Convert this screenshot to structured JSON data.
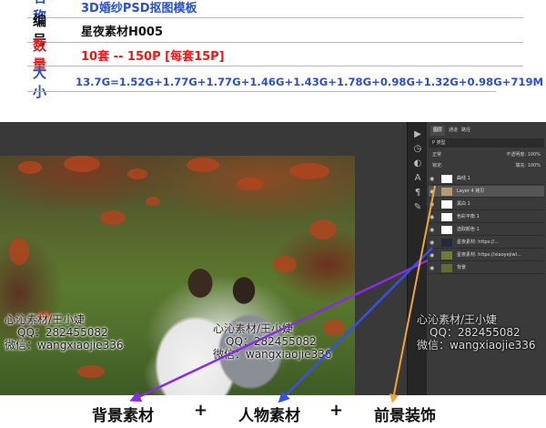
{
  "info": {
    "rows": [
      {
        "key": "名称",
        "value": "3D婚纱PSD抠图模板"
      },
      {
        "key": "编号",
        "value": "星夜素材H005"
      },
      {
        "key": "数量",
        "value": "10套 -- 150P [每套15P]"
      },
      {
        "key": "大小",
        "value": "13.7G=1.52G+1.77G+1.77G+1.46G+1.43G+1.78G+0.98G+1.32G+0.98G+719M"
      }
    ]
  },
  "layers_panel": {
    "tabs": [
      "图层",
      "通道",
      "路径"
    ],
    "filter_label": "P 类型",
    "mode_label": "正常",
    "opacity_label": "不透明度: 100%",
    "lock_label": "锁定:",
    "fill_label": "填充: 100%",
    "layers": [
      {
        "name": "曲线 1"
      },
      {
        "name": "Layer 4 拷贝"
      },
      {
        "name": "黑白 1"
      },
      {
        "name": "色彩平衡 1"
      },
      {
        "name": "选取颜色 1"
      },
      {
        "name": "星夜素材: https://..."
      },
      {
        "name": "星夜素材: https://xiaoyejiwl..."
      },
      {
        "name": "背景"
      }
    ]
  },
  "watermark": {
    "line1": "心沁素材/王小婕",
    "line2": "QQ：282455082",
    "line3": "微信：wangxiaojie336"
  },
  "captions": {
    "background": "背景素材",
    "people": "人物素材",
    "foreground": "前景装饰",
    "plus": "+"
  },
  "colors": {
    "title_blue": "#2a51c9",
    "quantity_red": "#e41b1b",
    "arrow_purple": "#8a2be2",
    "arrow_blue": "#3b4fe0",
    "arrow_orange": "#f2a43c"
  }
}
